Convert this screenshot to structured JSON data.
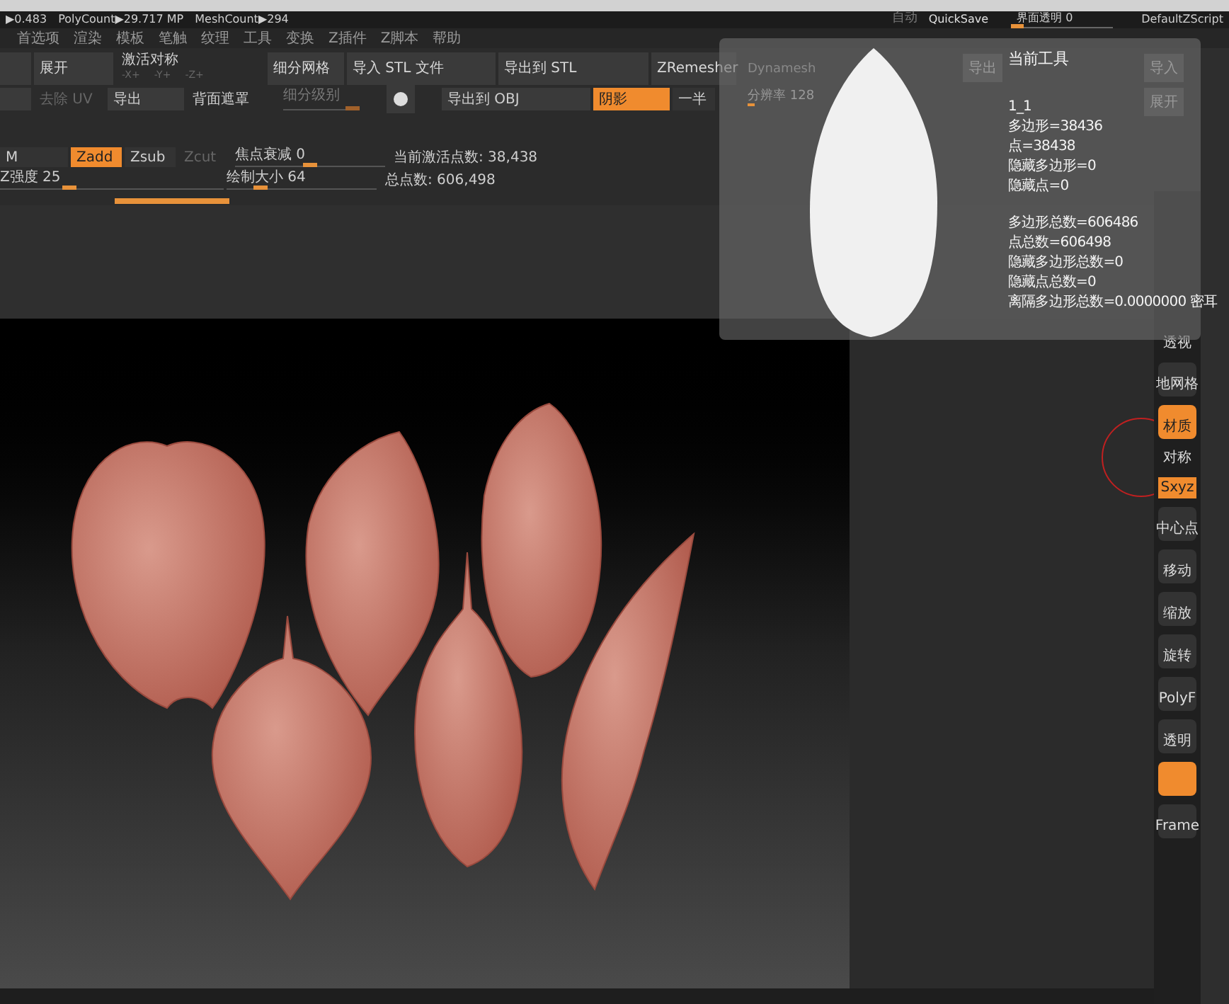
{
  "status_bar": {
    "items": [
      "▶0.483",
      "PolyCount▶29.717 MP",
      "MeshCount▶294"
    ],
    "auto_label": "自动",
    "quicksave": "QuickSave",
    "transparency": {
      "label": "界面透明 0",
      "level": 0.12
    },
    "script": "DefaultZScript"
  },
  "menu": [
    "首选项",
    "渲染",
    "模板",
    "笔触",
    "纹理",
    "工具",
    "变换",
    "Z插件",
    "Z脚本",
    "帮助"
  ],
  "toolbar": {
    "row_1": [
      {
        "kind": "button"
      },
      {
        "kind": "button",
        "label": "展开"
      },
      {
        "kind": "symmetry",
        "label": "激活对称",
        "axes": [
          "-X+",
          "-Y+",
          "-Z+"
        ]
      },
      {
        "kind": "button",
        "label": "细分网格"
      },
      {
        "kind": "button",
        "label": "导入 STL 文件"
      },
      {
        "kind": "button",
        "label": "导出到 STL"
      },
      {
        "kind": "button",
        "label": "ZRemesher"
      }
    ],
    "row_2": [
      {
        "kind": "button"
      },
      {
        "kind": "text",
        "label": "去除 UV",
        "disabled": true
      },
      {
        "kind": "field",
        "label": "导出"
      },
      {
        "kind": "text",
        "label": "背面遮罩",
        "disabled": false
      },
      {
        "kind": "slider",
        "label": "细分级别",
        "level": 1,
        "disabled": true
      },
      {
        "kind": "icon"
      },
      {
        "kind": "field",
        "label": "导出到 OBJ"
      },
      {
        "kind": "toggle",
        "label": "阴影",
        "on": true
      },
      {
        "kind": "toggle",
        "label": "一半",
        "on": false
      }
    ],
    "row_3": [
      {
        "kind": "toggle",
        "label": "M",
        "on": false
      },
      {
        "kind": "toggle",
        "label": "Zadd",
        "on": true
      },
      {
        "kind": "toggle",
        "label": "Zsub",
        "on": false
      },
      {
        "kind": "text",
        "label": "Zcut",
        "disabled": true
      },
      {
        "kind": "slider",
        "label": "焦点衰减 0",
        "level": 0.5,
        "disabled": false
      },
      {
        "kind": "text",
        "label": "当前激活点数: 38,438",
        "disabled": false
      }
    ],
    "row_4": [
      {
        "kind": "slider",
        "label": "Z强度 25",
        "level": 0.3,
        "disabled": false
      },
      {
        "kind": "slider",
        "label": "绘制大小 64",
        "level": 0.2,
        "disabled": false
      },
      {
        "kind": "text",
        "label": "总点数: 606,498",
        "disabled": false
      }
    ]
  },
  "tool_popup": {
    "dynamesh": "Dynamesh",
    "resolution": {
      "label": "分辨率 128",
      "level": 0.08
    },
    "buttons": [
      "导出",
      "导入",
      "展开"
    ],
    "title": "当前工具",
    "info": [
      "1_1",
      "多边形=38436",
      "点=38438",
      "隐藏多边形=0",
      "隐藏点=0"
    ],
    "totals": [
      "多边形总数=606486",
      "点总数=606498",
      "隐藏多边形总数=0",
      "隐藏点总数=0",
      "离隔多边形总数=0.0000000 密耳"
    ]
  },
  "shelf": [
    {
      "kind": "label",
      "label": "透视",
      "on": false
    },
    {
      "kind": "button",
      "label": "地网格",
      "on": false
    },
    {
      "kind": "button",
      "label": "材质",
      "on": true
    },
    {
      "kind": "label",
      "label": "对称",
      "on": false
    },
    {
      "kind": "label",
      "label": "Sxyz",
      "on": true
    },
    {
      "kind": "button",
      "label": "中心点",
      "on": false
    },
    {
      "kind": "button",
      "label": "移动",
      "on": false
    },
    {
      "kind": "button",
      "label": "缩放",
      "on": false
    },
    {
      "kind": "button",
      "label": "旋转",
      "on": false
    },
    {
      "kind": "button",
      "label": "PolyF",
      "on": false
    },
    {
      "kind": "button",
      "label": "透明",
      "on": false
    },
    {
      "kind": "button",
      "on": true
    },
    {
      "kind": "button",
      "label": "Frame",
      "on": false
    }
  ]
}
